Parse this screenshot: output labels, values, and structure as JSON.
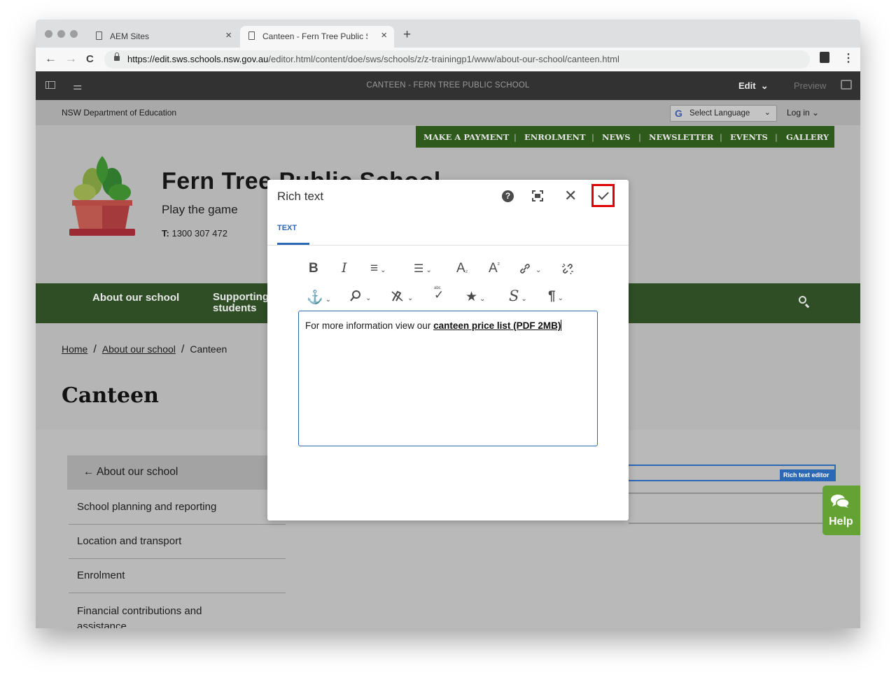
{
  "browser": {
    "tabs": [
      {
        "title": "AEM Sites",
        "close": "×"
      },
      {
        "title": "Canteen - Fern Tree Public Sch",
        "close": "×"
      }
    ],
    "new_tab": "+",
    "url_host": "https://edit.sws.schools.nsw.gov.au",
    "url_path": "/editor.html/content/doe/sws/schools/z/z-trainingp1/www/about-our-school/canteen.html",
    "back": "←",
    "forward": "→",
    "reload": "C",
    "menu": "⋮"
  },
  "aem": {
    "page_title": "CANTEEN - FERN TREE PUBLIC SCHOOL",
    "mode": "Edit",
    "mode_chevron": "⌄",
    "preview": "Preview",
    "sliders_icon": "⚌"
  },
  "site": {
    "department": "NSW Department of Education",
    "language": {
      "g": "G",
      "label": "Select Language",
      "chevron": "⌄"
    },
    "login": "Log in  ⌄",
    "utility_links": [
      "MAKE A PAYMENT",
      "ENROLMENT",
      "NEWS",
      "NEWSLETTER",
      "EVENTS",
      "GALLERY"
    ],
    "utility_sep": "|",
    "school_name": "Fern Tree Public School",
    "motto": "Play the game",
    "phone_label": "T:",
    "phone": "1300 307 472",
    "nav": {
      "item1": "About our school",
      "item2": "Supporting students"
    },
    "breadcrumb": {
      "home": "Home",
      "sep": "/",
      "about": "About our school",
      "current": "Canteen"
    },
    "page_heading": "Canteen",
    "sidenav": {
      "back": "← About our school",
      "items": [
        "School planning and reporting",
        "Location and transport",
        "Enrolment",
        "Financial contributions and assistance"
      ]
    },
    "rte_badge": "Rich text editor",
    "help": "Help"
  },
  "dialog": {
    "title": "Rich text",
    "help_icon": "?",
    "close_icon": "✕",
    "tab": "TEXT",
    "toolbar": {
      "bold": "B",
      "italic": "I",
      "justify": "≡",
      "list": "☰",
      "subscript": "A",
      "superscript": "A",
      "link": "🔗",
      "unlink": "⛓",
      "anchor": "⚓",
      "find": "⌕",
      "spellcheck": "✓",
      "special": "★",
      "styles": "S",
      "paragraph": "¶",
      "chevron": "⌄",
      "sub_mark": "₂",
      "sup_mark": "²",
      "abc": "abc"
    },
    "content_prefix": "For more information view our ",
    "content_link": "canteen price list (PDF 2MB)"
  }
}
